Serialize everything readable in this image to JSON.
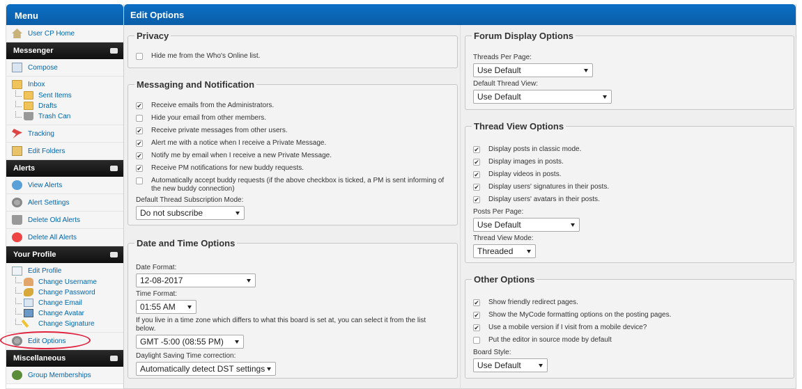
{
  "sidebar": {
    "title": "Menu",
    "home": "User CP Home",
    "messenger": {
      "title": "Messenger",
      "compose": "Compose",
      "inbox": "Inbox",
      "sent": "Sent Items",
      "drafts": "Drafts",
      "trash": "Trash Can",
      "tracking": "Tracking",
      "edit_folders": "Edit Folders"
    },
    "alerts": {
      "title": "Alerts",
      "view": "View Alerts",
      "settings": "Alert Settings",
      "delete_old": "Delete Old Alerts",
      "delete_all": "Delete All Alerts"
    },
    "profile": {
      "title": "Your Profile",
      "edit_profile": "Edit Profile",
      "change_username": "Change Username",
      "change_password": "Change Password",
      "change_email": "Change Email",
      "change_avatar": "Change Avatar",
      "change_signature": "Change Signature",
      "edit_options": "Edit Options"
    },
    "misc": {
      "title": "Miscellaneous",
      "group_memberships": "Group Memberships"
    }
  },
  "main": {
    "title": "Edit Options",
    "privacy": {
      "legend": "Privacy",
      "hide_online": {
        "label": "Hide me from the Who's Online list.",
        "checked": false
      }
    },
    "messaging": {
      "legend": "Messaging and Notification",
      "options": [
        {
          "label": "Receive emails from the Administrators.",
          "checked": true
        },
        {
          "label": "Hide your email from other members.",
          "checked": false
        },
        {
          "label": "Receive private messages from other users.",
          "checked": true
        },
        {
          "label": "Alert me with a notice when I receive a Private Message.",
          "checked": true
        },
        {
          "label": "Notify me by email when I receive a new Private Message.",
          "checked": true
        },
        {
          "label": "Receive PM notifications for new buddy requests.",
          "checked": true
        },
        {
          "label": "Automatically accept buddy requests (if the above checkbox is ticked, a PM is sent informing of the new buddy connection)",
          "checked": false
        }
      ],
      "subscription_label": "Default Thread Subscription Mode:",
      "subscription_value": "Do not subscribe"
    },
    "datetime": {
      "legend": "Date and Time Options",
      "date_format_label": "Date Format:",
      "date_format_value": "12-08-2017",
      "time_format_label": "Time Format:",
      "time_format_value": "01:55 AM",
      "timezone_note": "If you live in a time zone which differs to what this board is set at, you can select it from the list below.",
      "timezone_value": "GMT -5:00 (08:55 PM)",
      "dst_label": "Daylight Saving Time correction:",
      "dst_value": "Automatically detect DST settings"
    },
    "forum_display": {
      "legend": "Forum Display Options",
      "threads_per_page_label": "Threads Per Page:",
      "threads_per_page_value": "Use Default",
      "thread_view_label": "Default Thread View:",
      "thread_view_value": "Use Default"
    },
    "thread_view": {
      "legend": "Thread View Options",
      "options": [
        {
          "label": "Display posts in classic mode.",
          "checked": true
        },
        {
          "label": "Display images in posts.",
          "checked": true
        },
        {
          "label": "Display videos in posts.",
          "checked": true
        },
        {
          "label": "Display users' signatures in their posts.",
          "checked": true
        },
        {
          "label": "Display users' avatars in their posts.",
          "checked": true
        }
      ],
      "posts_per_page_label": "Posts Per Page:",
      "posts_per_page_value": "Use Default",
      "view_mode_label": "Thread View Mode:",
      "view_mode_value": "Threaded"
    },
    "other": {
      "legend": "Other Options",
      "options": [
        {
          "label": "Show friendly redirect pages.",
          "checked": true
        },
        {
          "label": "Show the MyCode formatting options on the posting pages.",
          "checked": true
        },
        {
          "label": "Use a mobile version if I visit from a mobile device?",
          "checked": true
        },
        {
          "label": "Put the editor in source mode by default",
          "checked": false
        }
      ],
      "board_style_label": "Board Style:",
      "board_style_value": "Use Default"
    }
  }
}
